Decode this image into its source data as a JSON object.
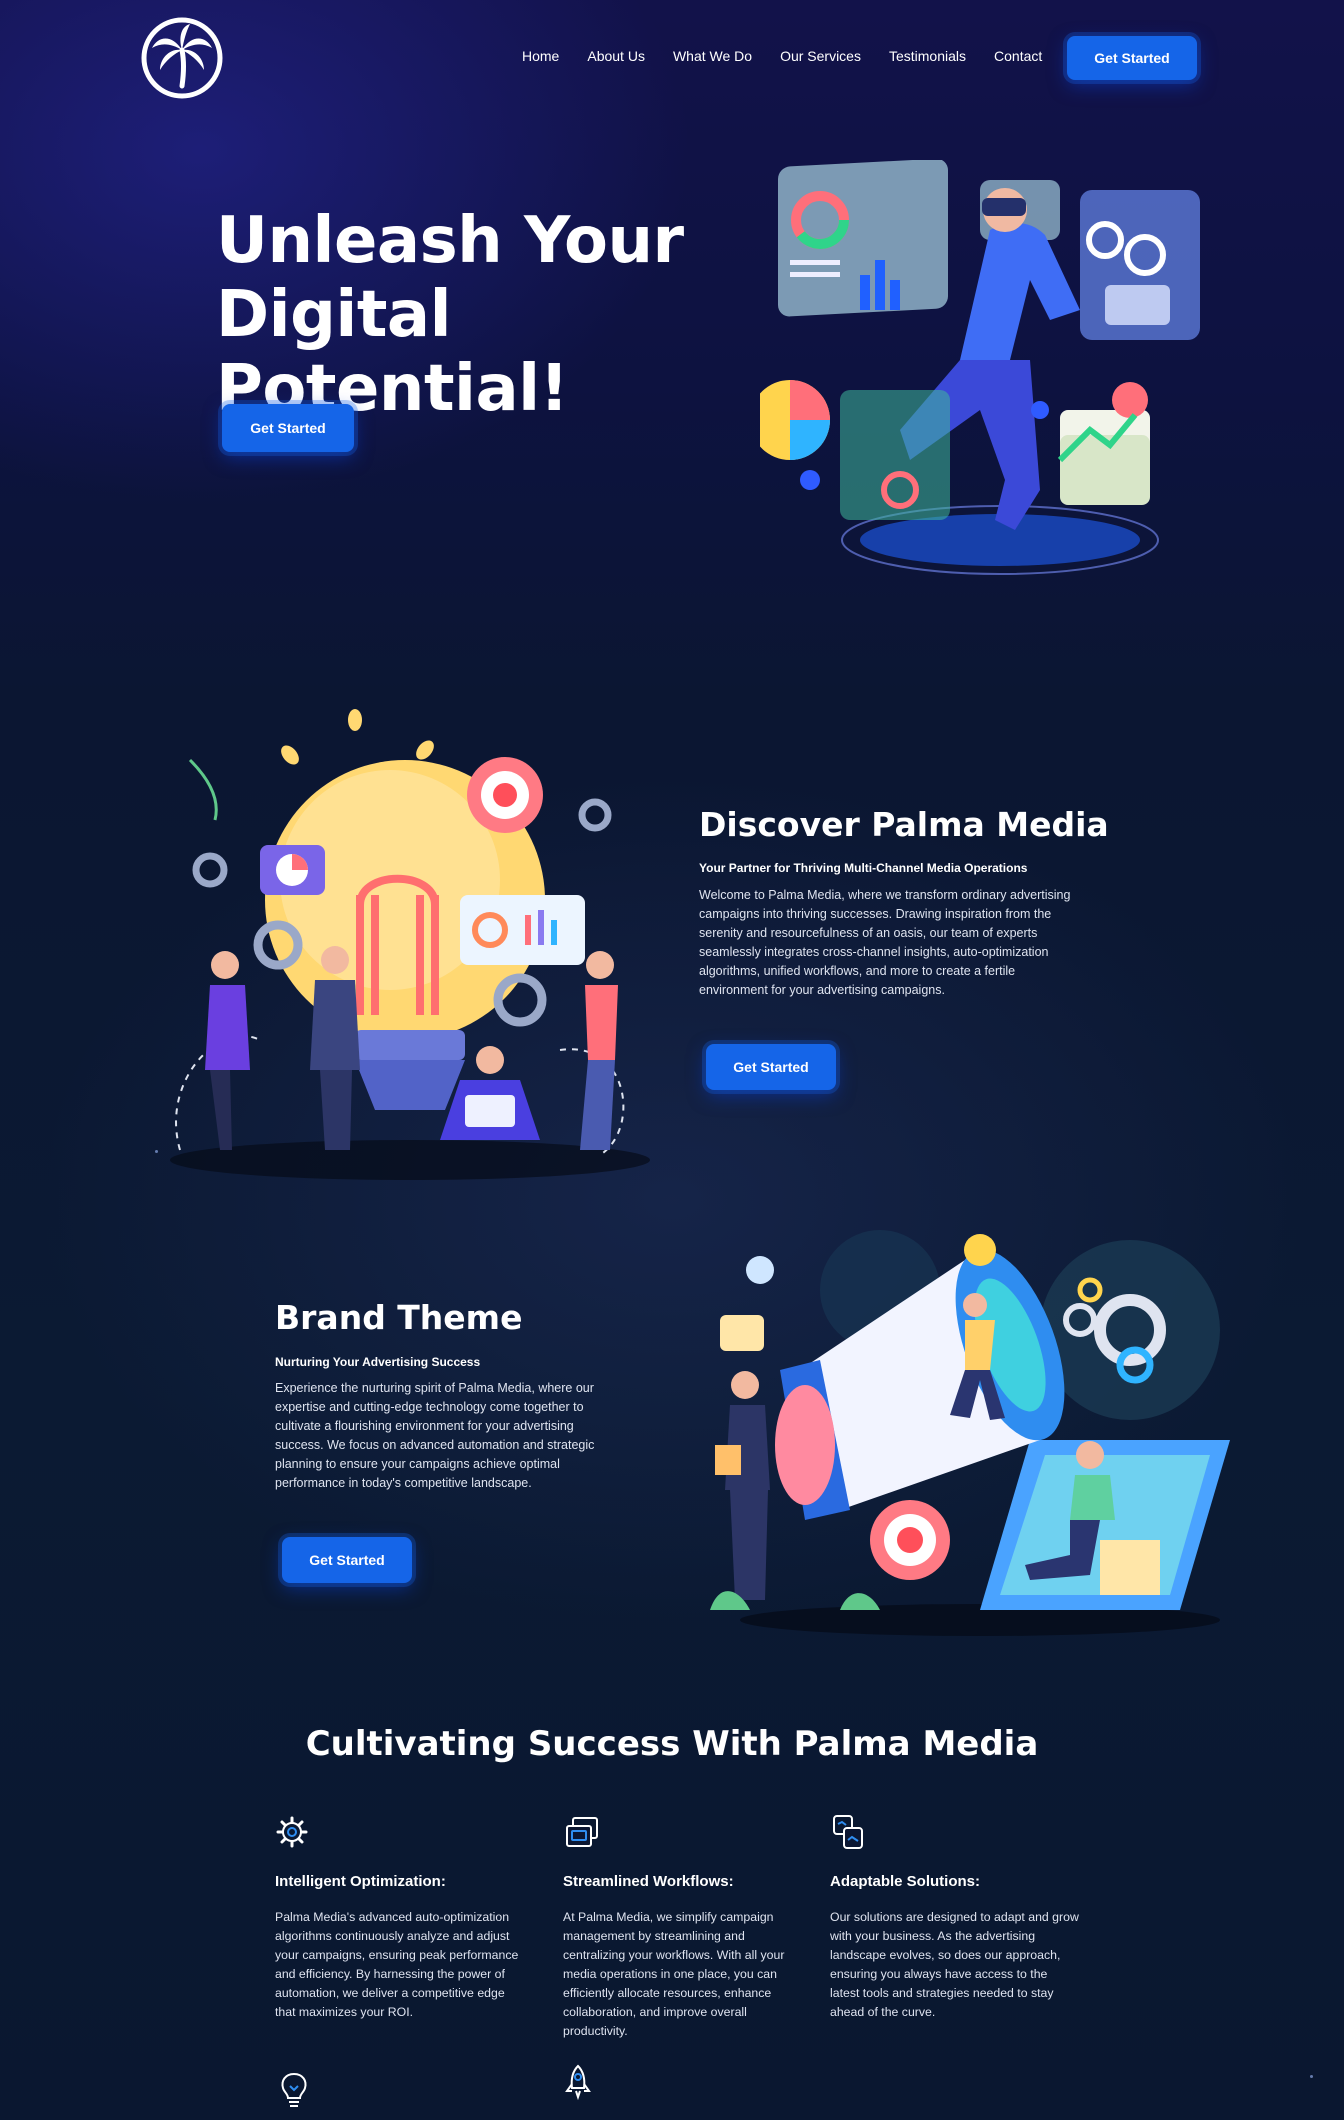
{
  "nav": {
    "items": [
      "Home",
      "About Us",
      "What We Do",
      "Our Services",
      "Testimonials",
      "Contact"
    ],
    "cta_label": "Get Started"
  },
  "hero": {
    "title_line1": "Unleash Your",
    "title_line2": "Digital Potential!",
    "cta_label": "Get Started"
  },
  "discover": {
    "title": "Discover Palma Media",
    "subtitle": "Your Partner for Thriving Multi-Channel Media Operations",
    "body": "Welcome to Palma Media, where we transform ordinary advertising campaigns into thriving successes. Drawing inspiration from the serenity and resourcefulness of an oasis, our team of experts seamlessly integrates cross-channel insights, auto-optimization algorithms, unified workflows, and more to create a fertile environment for your advertising campaigns.",
    "cta_label": "Get Started"
  },
  "brand": {
    "title": "Brand Theme",
    "subtitle": "Nurturing Your Advertising Success",
    "body": "Experience the nurturing spirit of Palma Media, where our expertise and cutting-edge technology come together to cultivate a flourishing environment for your advertising success. We focus on advanced automation and strategic planning to ensure your campaigns achieve optimal performance in today's competitive landscape.",
    "cta_label": "Get Started"
  },
  "cultivating": {
    "title": "Cultivating Success With Palma Media",
    "features": [
      {
        "icon": "gear-icon",
        "title": "Intelligent Optimization:",
        "body": "Palma Media's advanced auto-optimization algorithms continuously analyze and adjust your campaigns, ensuring peak performance and efficiency. By harnessing the power of automation, we deliver a competitive edge that maximizes your ROI."
      },
      {
        "icon": "workflow-icon",
        "title": "Streamlined Workflows:",
        "body": "At Palma Media, we simplify campaign management by streamlining and centralizing your workflows. With all your media operations in one place, you can efficiently allocate resources, enhance collaboration, and improve overall productivity."
      },
      {
        "icon": "adapt-icon",
        "title": "Adaptable Solutions:",
        "body": "Our solutions are designed to adapt and grow with your business. As the advertising landscape evolves, so does our approach, ensuring you always have access to the latest tools and strategies needed to stay ahead of the curve."
      }
    ],
    "more_icons": [
      "lightbulb-icon",
      "rocket-icon"
    ]
  },
  "colors": {
    "accent": "#1565e8",
    "background": "#0b1632"
  }
}
